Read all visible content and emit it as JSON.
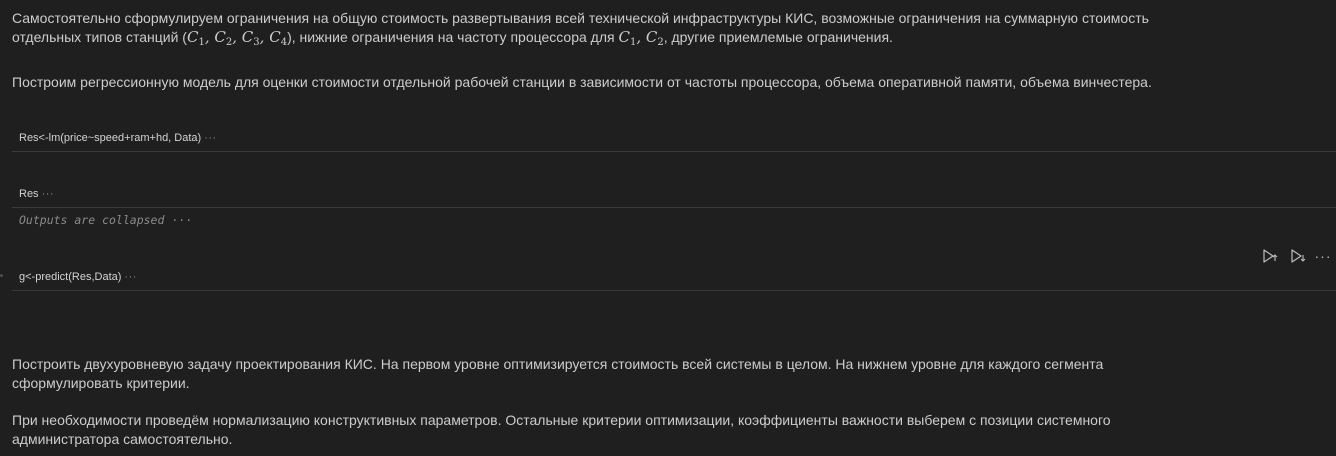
{
  "markdown": {
    "p1_line1": "Самостоятельно сформулируем ограничения на общую стоимость развертывания всей технической инфраструктуры КИС, возможные ограничения на суммарную стоимость",
    "p1_line2_pre": "отдельных типов станций (",
    "p1_line2_mid": "), нижние ограничения на частоту процессора для ",
    "p1_line2_post": ", другие приемлемые ограничения.",
    "math_letter": "C",
    "math_subs": [
      "1",
      "2",
      "3",
      "4"
    ],
    "math_sep": ", ",
    "p2": "Построим регрессионную модель для оценки стоимости отдельной рабочей станции в зависимости от частоты процессора, объема оперативной памяти, объема винчестера.",
    "p3_line1": "Построить двухуровневую задачу проектирования КИС. На первом уровне оптимизируется стоимость всей системы в целом. На нижнем уровне для каждого сегмента",
    "p3_line2": "сформулировать критерии.",
    "p4_line1": "При необходимости проведём нормализацию конструктивных параметров. Остальные критерии оптимизации, коэффициенты важности выберем с позиции системного",
    "p4_line2": "администратора самостоятельно."
  },
  "cells": [
    {
      "code": "Res<-lm(price~speed+ram+hd, Data)",
      "collapsed_marker": "···"
    },
    {
      "code": "Res",
      "collapsed_marker": "···"
    },
    {
      "code": "g<-predict(Res,Data)",
      "collapsed_marker": "···"
    }
  ],
  "outputs": {
    "collapsed_label": "Outputs are collapsed",
    "collapsed_marker": "···"
  },
  "toolbar": {
    "icons": [
      "run-above-icon",
      "run-below-icon",
      "more-actions-icon"
    ],
    "more_label": "···"
  },
  "colors": {
    "background": "#1f1f1f",
    "text": "#cccccc",
    "muted": "#858585",
    "divider": "#3a3a3a"
  }
}
